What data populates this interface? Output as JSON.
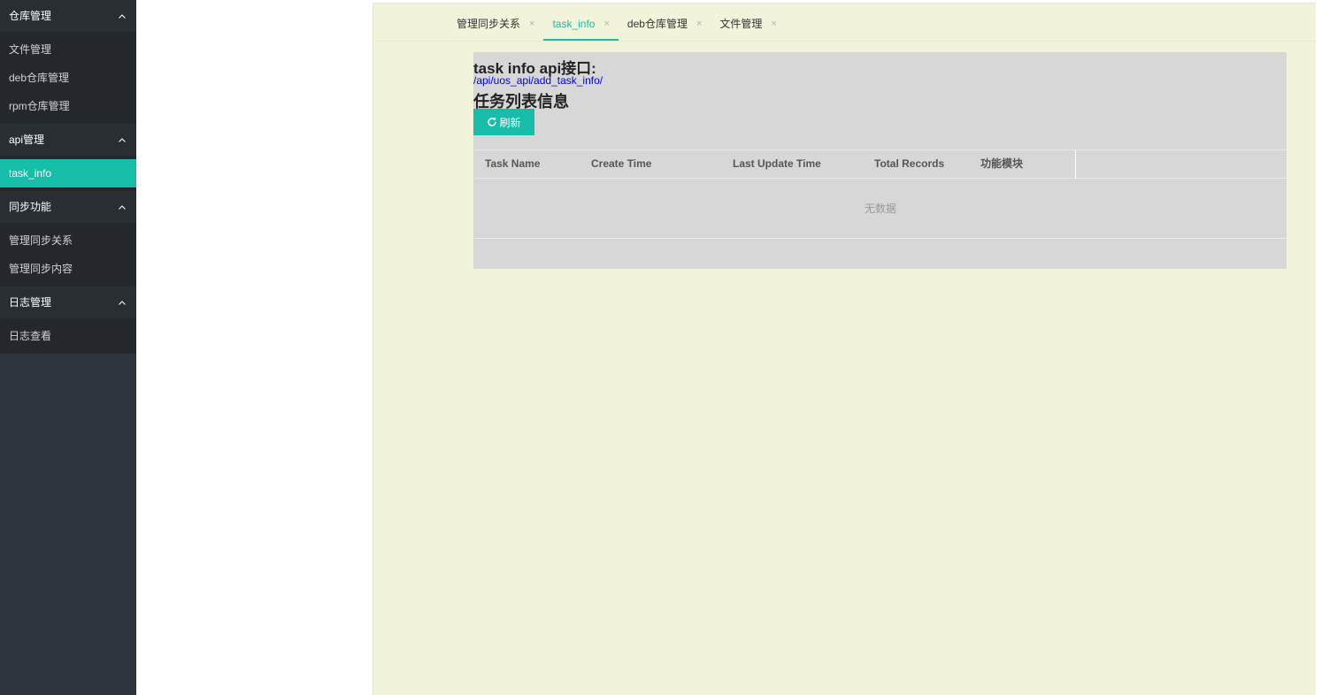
{
  "sidebar": {
    "groups": [
      {
        "title": "仓库管理",
        "items": [
          "文件管理",
          "deb仓库管理",
          "rpm仓库管理"
        ]
      },
      {
        "title": "api管理",
        "items": [
          "task_info"
        ]
      },
      {
        "title": "同步功能",
        "items": [
          "管理同步关系",
          "管理同步内容"
        ]
      },
      {
        "title": "日志管理",
        "items": [
          "日志查看"
        ]
      }
    ],
    "active_item": "task_info"
  },
  "tabs": [
    {
      "label": "管理同步关系",
      "close": "×"
    },
    {
      "label": "task_info",
      "close": "×"
    },
    {
      "label": "deb仓库管理",
      "close": "×"
    },
    {
      "label": "文件管理",
      "close": "×"
    }
  ],
  "content": {
    "api_title": "task info api接口:",
    "api_url": "/api/uos_api/add_task_info/",
    "list_title": "任务列表信息",
    "refresh_label": "刷新",
    "table": {
      "columns": [
        "Task Name",
        "Create Time",
        "Last Update Time",
        "Total Records",
        "功能模块"
      ],
      "empty_text": "无数据"
    }
  },
  "colors": {
    "accent": "#17bda9",
    "sidebar_bg": "#2f353c",
    "main_bg": "#f2f3db",
    "link": "#0000ee"
  },
  "icons": {
    "sidebar_group_toggle": "chevron-up-icon",
    "tab_close": "close-icon",
    "refresh": "refresh-icon"
  }
}
